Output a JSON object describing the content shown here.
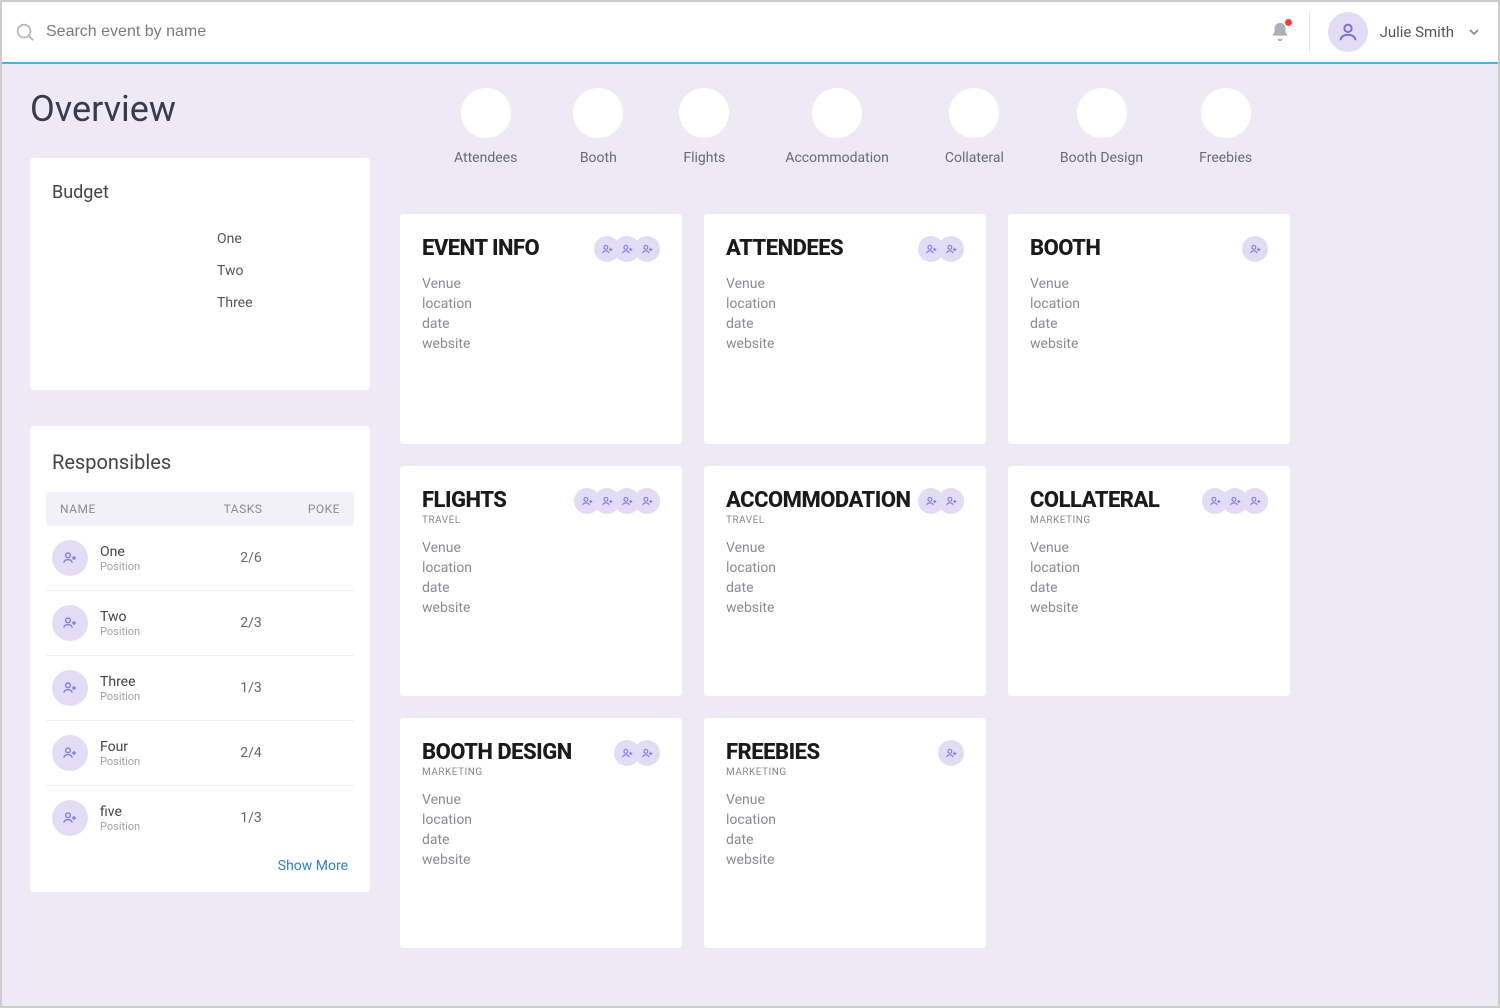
{
  "search": {
    "placeholder": "Search event by name"
  },
  "user": {
    "name": "Julie Smith"
  },
  "page_title": "Overview",
  "budget": {
    "title": "Budget",
    "legend": [
      "One",
      "Two",
      "Three"
    ]
  },
  "responsibles": {
    "title": "Responsibles",
    "columns": {
      "name": "NAME",
      "tasks": "TASKS",
      "poke": "POKE"
    },
    "rows": [
      {
        "name": "One",
        "position": "Position",
        "tasks": "2/6"
      },
      {
        "name": "Two",
        "position": "Position",
        "tasks": "2/3"
      },
      {
        "name": "Three",
        "position": "Position",
        "tasks": "1/3"
      },
      {
        "name": "Four",
        "position": "Position",
        "tasks": "2/4"
      },
      {
        "name": "five",
        "position": "Position",
        "tasks": "1/3"
      }
    ],
    "show_more": "Show More"
  },
  "progress": [
    {
      "label": "Attendees"
    },
    {
      "label": "Booth"
    },
    {
      "label": "Flights"
    },
    {
      "label": "Accommodation"
    },
    {
      "label": "Collateral"
    },
    {
      "label": "Booth Design"
    },
    {
      "label": "Freebies"
    }
  ],
  "cards": [
    {
      "title": "EVENT INFO",
      "subtitle": "",
      "people": 3,
      "fields": [
        "Venue",
        "location",
        "date",
        "website"
      ]
    },
    {
      "title": "ATTENDEES",
      "subtitle": "",
      "people": 2,
      "fields": [
        "Venue",
        "location",
        "date",
        "website"
      ]
    },
    {
      "title": "BOOTH",
      "subtitle": "",
      "people": 1,
      "fields": [
        "Venue",
        "location",
        "date",
        "website"
      ]
    },
    {
      "title": "FLIGHTS",
      "subtitle": "TRAVEL",
      "people": 4,
      "fields": [
        "Venue",
        "location",
        "date",
        "website"
      ]
    },
    {
      "title": "ACCOMMODATION",
      "subtitle": "TRAVEL",
      "people": 2,
      "fields": [
        "Venue",
        "location",
        "date",
        "website"
      ]
    },
    {
      "title": "COLLATERAL",
      "subtitle": "MARKETING",
      "people": 3,
      "fields": [
        "Venue",
        "location",
        "date",
        "website"
      ]
    },
    {
      "title": "BOOTH DESIGN",
      "subtitle": "MARKETING",
      "people": 2,
      "fields": [
        "Venue",
        "location",
        "date",
        "website"
      ]
    },
    {
      "title": "FREEBIES",
      "subtitle": "MARKETING",
      "people": 1,
      "fields": [
        "Venue",
        "location",
        "date",
        "website"
      ]
    }
  ]
}
